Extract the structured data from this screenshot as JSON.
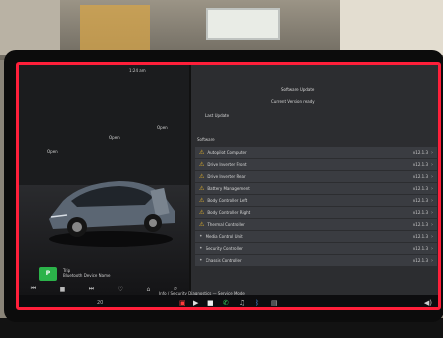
{
  "vehicle": {
    "status_text": "1:24 am",
    "door_labels": [
      "Open",
      "Open",
      "Open"
    ],
    "park_label": "P",
    "trip_line1": "Trip",
    "trip_line2": "Bluetooth Device Name",
    "car_color": "#5b6673"
  },
  "settings": {
    "header_line1": "Software Update",
    "header_line2": "Current Version ready",
    "header_line3": "Last Update",
    "section_label": "Software",
    "rows": [
      {
        "name": "Autopilot Computer",
        "value": "v12.1.3",
        "warn": true
      },
      {
        "name": "Drive Inverter Front",
        "value": "v12.1.3",
        "warn": true
      },
      {
        "name": "Drive Inverter Rear",
        "value": "v12.1.3",
        "warn": true
      },
      {
        "name": "Battery Management",
        "value": "v12.1.3",
        "warn": true
      },
      {
        "name": "Body Controller Left",
        "value": "v12.1.3",
        "warn": true
      },
      {
        "name": "Body Controller Right",
        "value": "v12.1.3",
        "warn": true
      },
      {
        "name": "Thermal Controller",
        "value": "v12.1.3",
        "warn": true
      },
      {
        "name": "Media Control Unit",
        "value": "v12.1.3",
        "warn": false
      },
      {
        "name": "Security Controller",
        "value": "v12.1.3",
        "warn": false
      },
      {
        "name": "Chassis Controller",
        "value": "v12.1.3",
        "warn": false
      }
    ]
  },
  "taskbar": {
    "footer_text": "Info / Security Diagnostics — Service Mode",
    "temperature": "20",
    "icons": [
      "car-icon",
      "phone-icon",
      "music-icon",
      "app-icon",
      "bluetooth-icon",
      "app2-icon"
    ],
    "volume_icon": "volume-icon"
  },
  "colors": {
    "warning": "#e9b62b",
    "screen_border": "#ff1f3a",
    "park_green": "#2bb34a"
  }
}
